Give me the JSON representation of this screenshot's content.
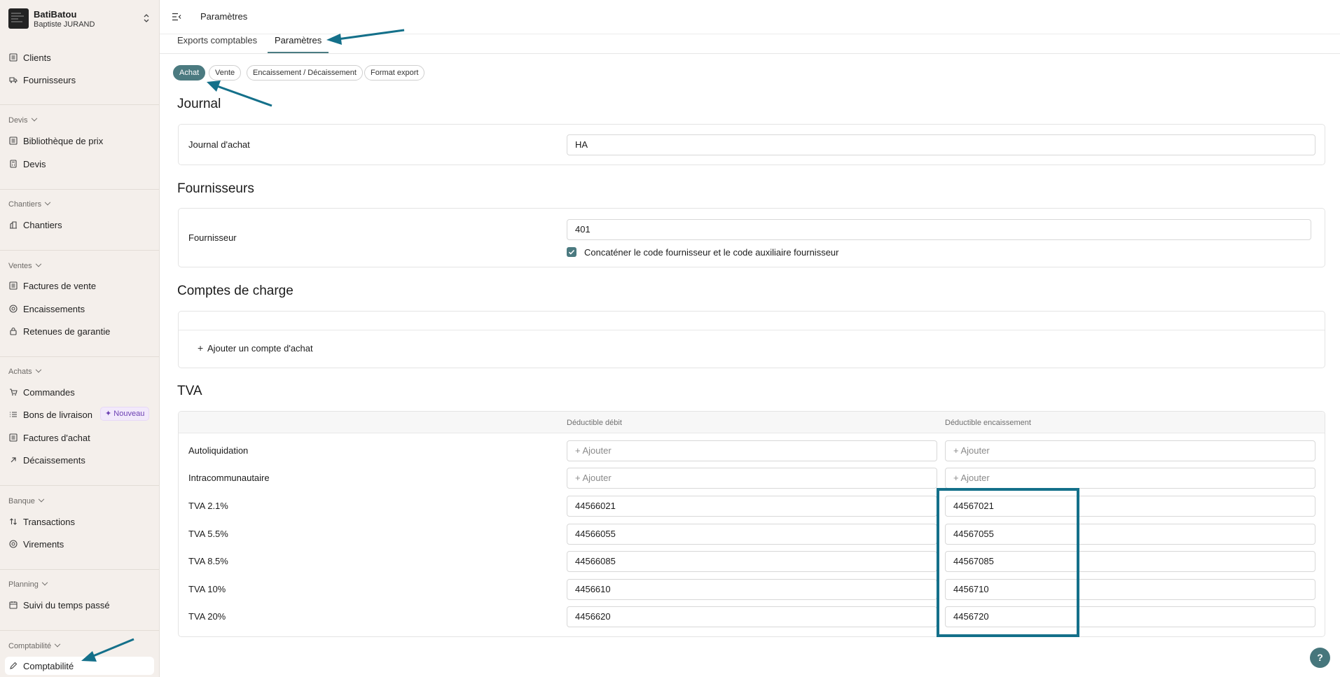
{
  "sidebar": {
    "brand": {
      "name": "BatiBatou",
      "user": "Baptiste JURAND"
    },
    "items": {
      "clients": "Clients",
      "fournisseurs": "Fournisseurs",
      "bibliotheque": "Bibliothèque de prix",
      "devis": "Devis",
      "chantiers": "Chantiers",
      "factures_vente": "Factures de vente",
      "encaissements": "Encaissements",
      "retenues": "Retenues de garantie",
      "commandes": "Commandes",
      "bons_livraison": "Bons de livraison",
      "factures_achat": "Factures d'achat",
      "decaissements": "Décaissements",
      "transactions": "Transactions",
      "virements": "Virements",
      "suivi_temps": "Suivi du temps passé",
      "comptabilite": "Comptabilité"
    },
    "groups": {
      "devis": "Devis",
      "chantiers": "Chantiers",
      "ventes": "Ventes",
      "achats": "Achats",
      "banque": "Banque",
      "planning": "Planning",
      "comptabilite": "Comptabilité"
    },
    "badge_new": "Nouveau"
  },
  "header": {
    "title": "Paramètres"
  },
  "tabs": {
    "exports": "Exports comptables",
    "parametres": "Paramètres"
  },
  "subtabs": {
    "achat": "Achat",
    "vente": "Vente",
    "encaissement": "Encaissement / Décaissement",
    "format": "Format export"
  },
  "journal": {
    "title": "Journal",
    "label": "Journal d'achat",
    "value": "HA"
  },
  "fournisseurs": {
    "title": "Fournisseurs",
    "label": "Fournisseur",
    "value": "401",
    "checkbox_label": "Concaténer le code fournisseur et le code auxiliaire fournisseur",
    "checked": true
  },
  "comptes_charge": {
    "title": "Comptes de charge",
    "add_label": "Ajouter un compte d'achat"
  },
  "tva": {
    "title": "TVA",
    "col_debit": "Déductible débit",
    "col_encaissement": "Déductible encaissement",
    "rows": [
      {
        "label": "Autoliquidation",
        "debit": "",
        "encaissement": ""
      },
      {
        "label": "Intracommunautaire",
        "debit": "",
        "encaissement": ""
      },
      {
        "label": "TVA 2.1%",
        "debit": "44566021",
        "encaissement": "44567021"
      },
      {
        "label": "TVA 5.5%",
        "debit": "44566055",
        "encaissement": "44567055"
      },
      {
        "label": "TVA 8.5%",
        "debit": "44566085",
        "encaissement": "44567085"
      },
      {
        "label": "TVA 10%",
        "debit": "4456610",
        "encaissement": "4456710"
      },
      {
        "label": "TVA 20%",
        "debit": "4456620",
        "encaissement": "4456720"
      }
    ],
    "placeholder": "+ Ajouter"
  },
  "help": "?",
  "colors": {
    "accent": "#4b7a80",
    "annotation": "#14708a"
  }
}
